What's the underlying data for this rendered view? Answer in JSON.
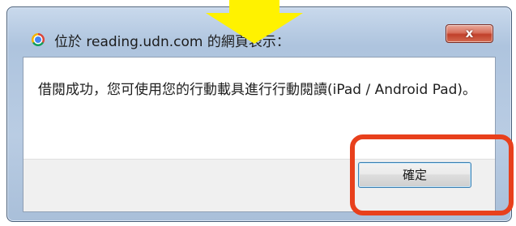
{
  "dialog": {
    "title": "位於 reading.udn.com 的網頁表示：",
    "close_label": "x",
    "message": "借閱成功，您可使用您的行動載具進行行動閱讀(iPad / Android Pad)。",
    "ok_label": "確定"
  },
  "annotations": {
    "arrow_color": "#fff200",
    "highlight_color": "#e8401c"
  },
  "icons": {
    "browser": "chrome-icon"
  }
}
